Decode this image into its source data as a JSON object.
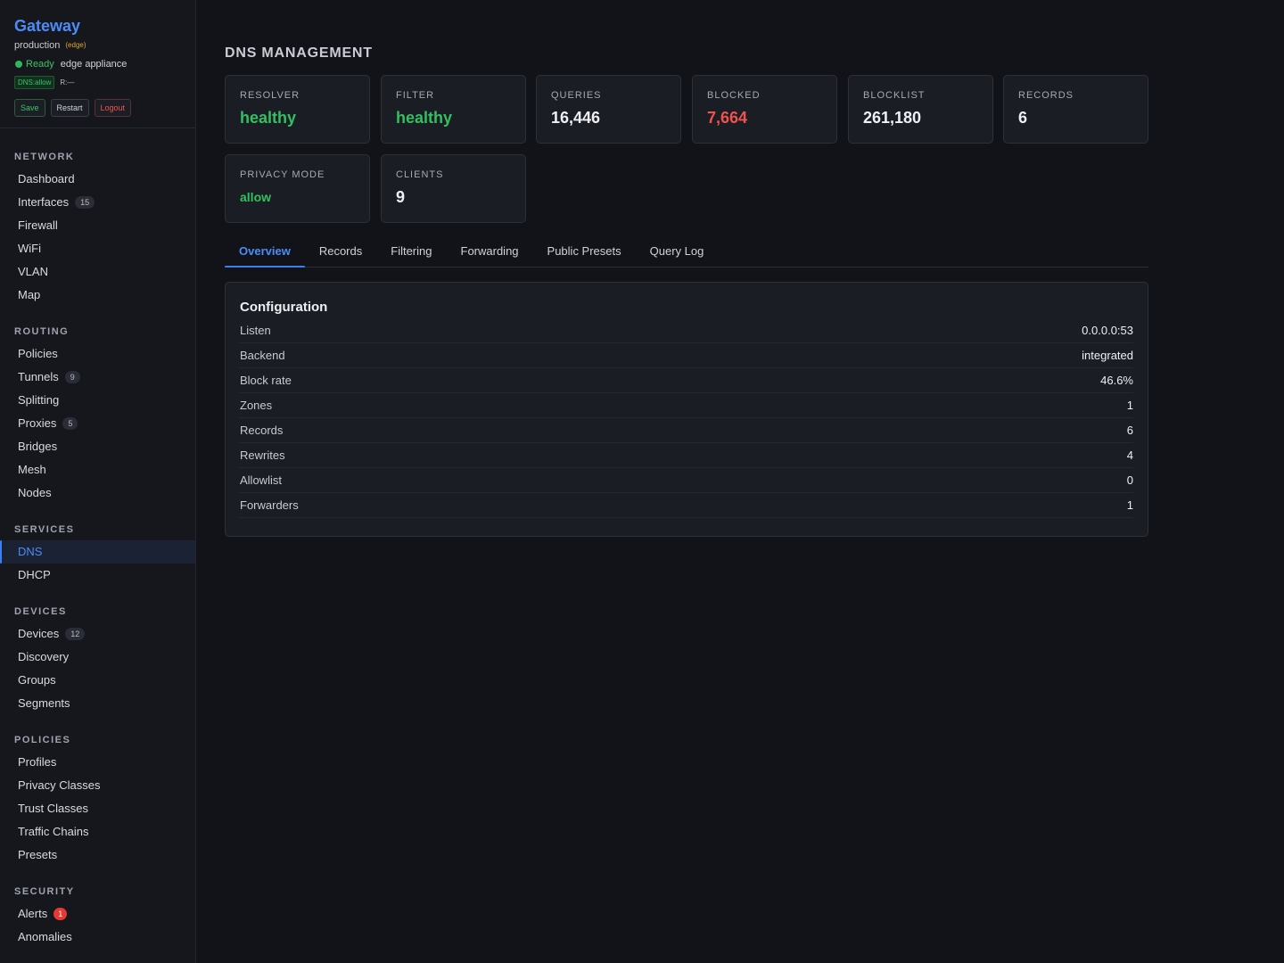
{
  "brand": {
    "title": "Gateway",
    "environment": "production",
    "env_tag": "(edge)",
    "status": "Ready",
    "appliance": "edge appliance",
    "dns_tag": "DNS:allow",
    "r_tag": "R:—",
    "buttons": {
      "save": "Save",
      "restart": "Restart",
      "logout": "Logout"
    }
  },
  "sidebar": {
    "sections": [
      {
        "title": "NETWORK",
        "items": [
          {
            "label": "Dashboard"
          },
          {
            "label": "Interfaces",
            "badge": "15"
          },
          {
            "label": "Firewall"
          },
          {
            "label": "WiFi"
          },
          {
            "label": "VLAN"
          },
          {
            "label": "Map"
          }
        ]
      },
      {
        "title": "ROUTING",
        "items": [
          {
            "label": "Policies"
          },
          {
            "label": "Tunnels",
            "badge": "9"
          },
          {
            "label": "Splitting"
          },
          {
            "label": "Proxies",
            "badge": "5"
          },
          {
            "label": "Bridges"
          },
          {
            "label": "Mesh"
          },
          {
            "label": "Nodes"
          }
        ]
      },
      {
        "title": "SERVICES",
        "items": [
          {
            "label": "DNS",
            "active": true
          },
          {
            "label": "DHCP"
          }
        ]
      },
      {
        "title": "DEVICES",
        "items": [
          {
            "label": "Devices",
            "badge": "12"
          },
          {
            "label": "Discovery"
          },
          {
            "label": "Groups"
          },
          {
            "label": "Segments"
          }
        ]
      },
      {
        "title": "POLICIES",
        "items": [
          {
            "label": "Profiles"
          },
          {
            "label": "Privacy Classes"
          },
          {
            "label": "Trust Classes"
          },
          {
            "label": "Traffic Chains"
          },
          {
            "label": "Presets"
          }
        ]
      },
      {
        "title": "SECURITY",
        "items": [
          {
            "label": "Alerts",
            "badge": "1",
            "alert": true
          },
          {
            "label": "Anomalies"
          }
        ]
      }
    ]
  },
  "main": {
    "title": "DNS MANAGEMENT",
    "stats": {
      "resolver": {
        "label": "RESOLVER",
        "value": "healthy"
      },
      "filter": {
        "label": "FILTER",
        "value": "healthy"
      },
      "queries": {
        "label": "QUERIES",
        "value": "16,446"
      },
      "blocked": {
        "label": "BLOCKED",
        "value": "7,664"
      },
      "blocklist": {
        "label": "BLOCKLIST",
        "value": "261,180"
      },
      "records": {
        "label": "RECORDS",
        "value": "6"
      },
      "privacy": {
        "label": "PRIVACY MODE",
        "value": "allow"
      },
      "clients": {
        "label": "CLIENTS",
        "value": "9"
      }
    },
    "tabs": [
      "Overview",
      "Records",
      "Filtering",
      "Forwarding",
      "Public Presets",
      "Query Log"
    ],
    "active_tab": "Overview",
    "config": {
      "title": "Configuration",
      "rows": [
        {
          "key": "Listen",
          "value": "0.0.0.0:53"
        },
        {
          "key": "Backend",
          "value": "integrated"
        },
        {
          "key": "Block rate",
          "value": "46.6%"
        },
        {
          "key": "Zones",
          "value": "1"
        },
        {
          "key": "Records",
          "value": "6"
        },
        {
          "key": "Rewrites",
          "value": "4"
        },
        {
          "key": "Allowlist",
          "value": "0"
        },
        {
          "key": "Forwarders",
          "value": "1"
        }
      ]
    }
  },
  "colors": {
    "accent": "#4a8df8",
    "healthy": "#33c061",
    "danger": "#ef5350",
    "warning": "#e0a92a",
    "background": "#121318"
  }
}
